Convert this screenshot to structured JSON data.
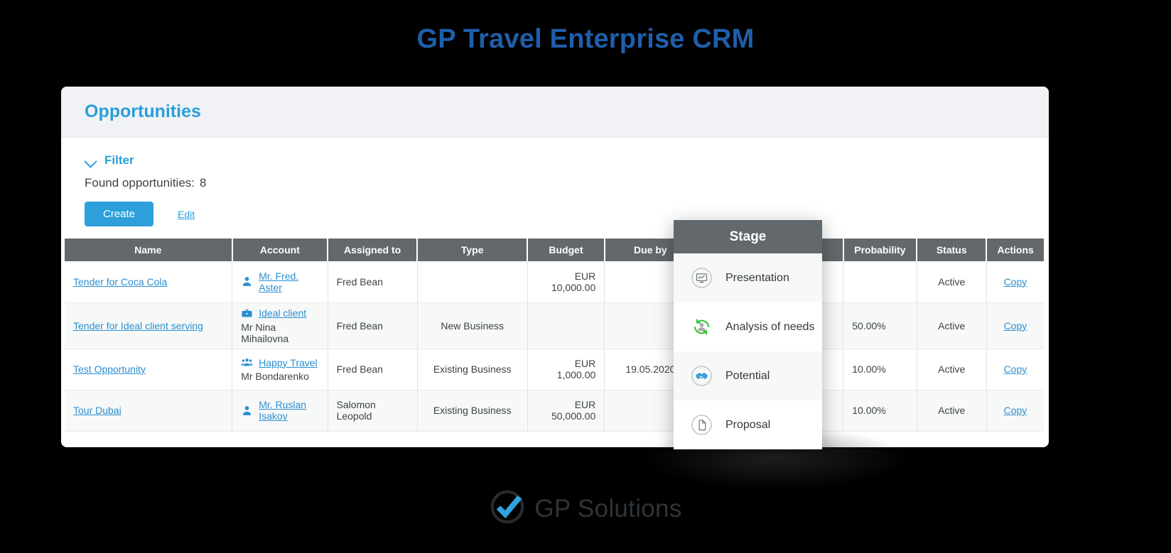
{
  "page": {
    "title": "GP Travel Enterprise CRM"
  },
  "card": {
    "header_title": "Opportunities",
    "filter_label": "Filter",
    "found_label": "Found opportunities:",
    "found_count": "8",
    "create_button": "Create",
    "edit_link": "Edit"
  },
  "table": {
    "columns": [
      "Name",
      "Account",
      "Assigned to",
      "Type",
      "Budget",
      "Due by",
      "Stage",
      "Probability",
      "Status",
      "Actions"
    ],
    "rows": [
      {
        "name": "Tender for Coca Cola",
        "account_icon": "person-icon",
        "account_link": "Mr. Fred. Aster",
        "account_sub": "",
        "assigned_to": "Fred Bean",
        "type": "",
        "budget": "EUR 10,000.00",
        "due_by": "",
        "stage": "",
        "probability": "",
        "status": "Active",
        "action": "Copy"
      },
      {
        "name": "Tender for Ideal client serving",
        "account_icon": "briefcase-icon",
        "account_link": "Ideal client",
        "account_sub": "Mr Nina Mihailovna",
        "assigned_to": "Fred Bean",
        "type": "New Business",
        "budget": "",
        "due_by": "",
        "stage": "",
        "probability": "50.00%",
        "status": "Active",
        "action": "Copy"
      },
      {
        "name": "Test Opportunity",
        "account_icon": "group-icon",
        "account_link": "Happy Travel",
        "account_sub": "Mr Bondarenko",
        "assigned_to": "Fred Bean",
        "type": "Existing Business",
        "budget": "EUR 1,000.00",
        "due_by": "19.05.2020",
        "stage": "",
        "probability": "10.00%",
        "status": "Active",
        "action": "Copy"
      },
      {
        "name": "Tour Dubai",
        "account_icon": "person-icon",
        "account_link": "Mr. Ruslan Isakov",
        "account_sub": "",
        "assigned_to": "Salomon Leopold",
        "type": "Existing Business",
        "budget": "EUR 50,000.00",
        "due_by": "",
        "stage": "",
        "probability": "10.00%",
        "status": "Active",
        "action": "Copy"
      }
    ]
  },
  "stage_popup": {
    "title": "Stage",
    "items": [
      {
        "label": "Presentation",
        "icon": "presentation-monitor-icon"
      },
      {
        "label": "Analysis of needs",
        "icon": "person-refresh-icon"
      },
      {
        "label": "Potential",
        "icon": "handshake-icon"
      },
      {
        "label": "Proposal",
        "icon": "document-icon"
      }
    ]
  },
  "footer": {
    "logo_text": "GP Solutions",
    "logo_icon": "check-circle-icon"
  },
  "colors": {
    "title_blue": "#1f5faa",
    "accent_blue": "#2a9fd8",
    "link_blue": "#2a8fd0",
    "header_gray": "#63686c",
    "green": "#3fbf3f",
    "page_bg": "#000000"
  }
}
